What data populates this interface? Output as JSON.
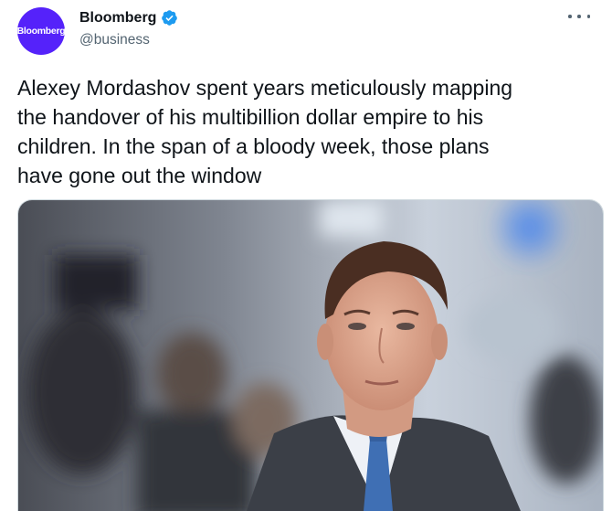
{
  "author": {
    "display_name": "Bloomberg",
    "handle": "@business",
    "avatar_text": "Bloomberg",
    "avatar_color": "#5522fa",
    "verified": true,
    "verified_color": "#1d9bf0"
  },
  "more_menu": {
    "icon": "more-horizontal-icon"
  },
  "tweet": {
    "text": "Alexey Mordashov spent years meticulously mapping\nthe handover of his multibillion dollar empire to his\nchildren. In the span of a bloody week, those plans\nhave gone out the window"
  },
  "media": {
    "type": "photo",
    "subject": "man in suit and blue tie at conference"
  },
  "colors": {
    "text": "#0f1419",
    "secondary": "#536471",
    "border": "#cfd9de"
  }
}
